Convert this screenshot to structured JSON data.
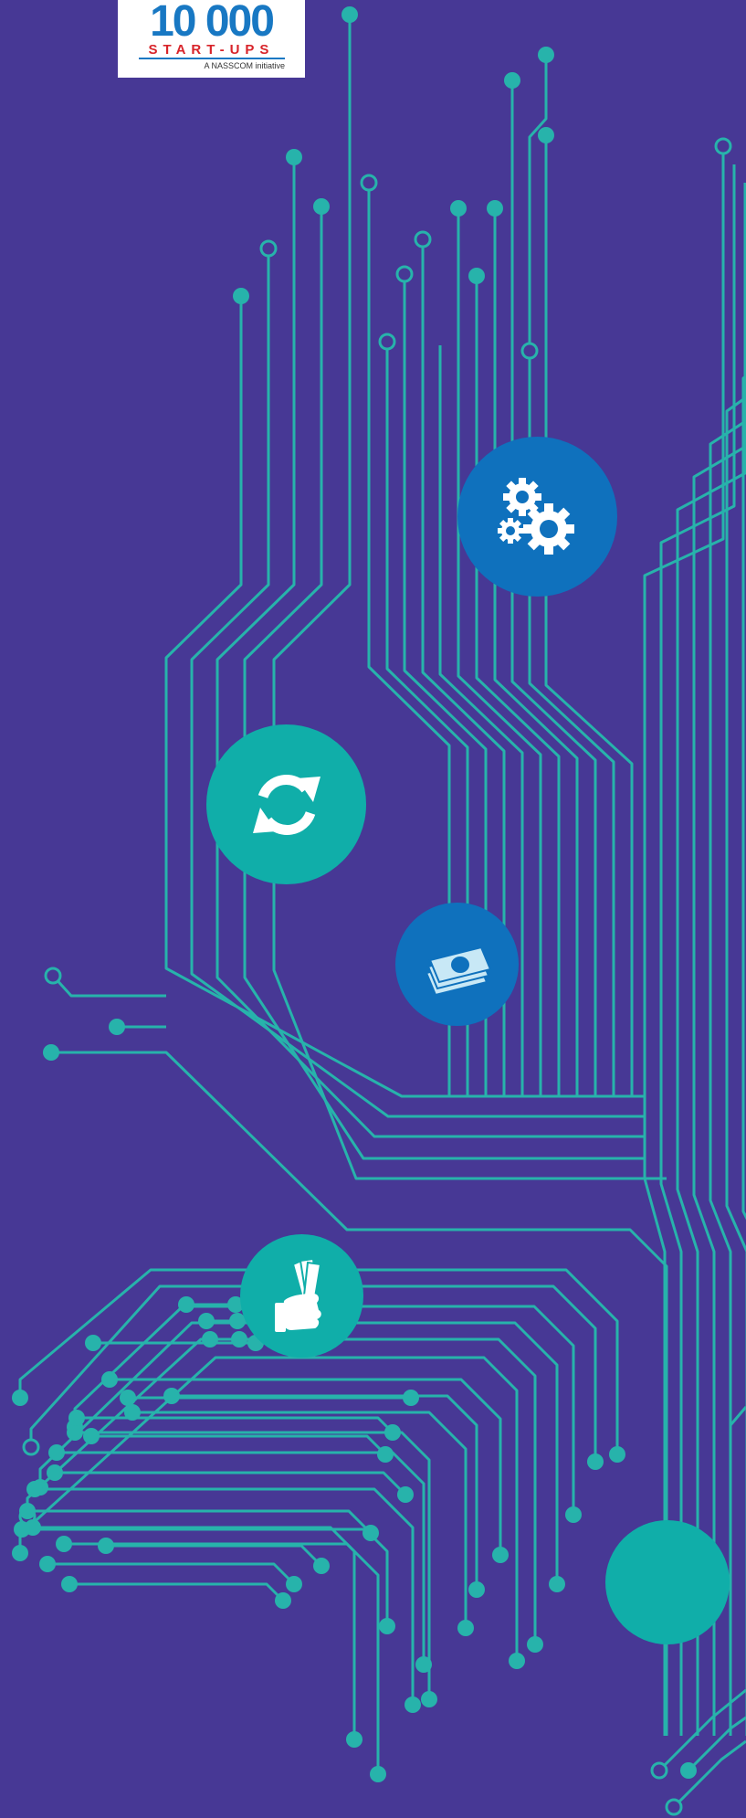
{
  "logo": {
    "number": "10 000",
    "subtitle": "START-UPS",
    "tagline": "A NASSCOM initiative"
  },
  "colors": {
    "background": "#473895",
    "circuit": "#27b3ab",
    "badge_blue": "#0f71bd",
    "badge_teal": "#10aea9",
    "logo_blue": "#1878c3",
    "logo_red": "#d8242a"
  },
  "badges": [
    {
      "icon": "gears-icon"
    },
    {
      "icon": "sync-icon"
    },
    {
      "icon": "money-icon"
    },
    {
      "icon": "hand-money-icon"
    },
    {
      "icon": "none"
    }
  ]
}
